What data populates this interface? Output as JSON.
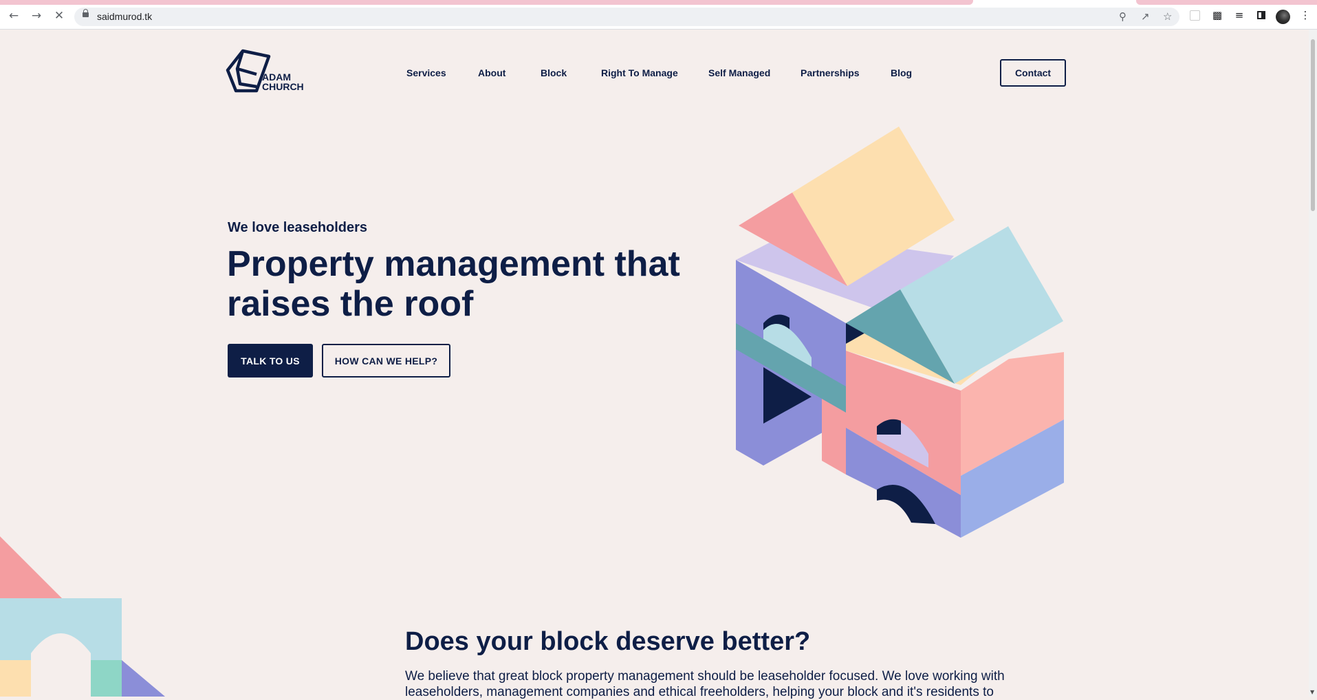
{
  "browser": {
    "url": "saidmurod.tk",
    "back_icon": "arrow-left-icon",
    "forward_icon": "arrow-right-icon",
    "stop_icon": "close-icon"
  },
  "site": {
    "logo_line1": "ADAM",
    "logo_line2": "CHURCH",
    "nav": [
      "Services",
      "About",
      "Block",
      "Right To Manage",
      "Self Managed",
      "Partnerships",
      "Blog"
    ],
    "contact_label": "Contact"
  },
  "hero": {
    "eyebrow": "We love leaseholders",
    "title": "Property management that raises the roof",
    "primary_cta": "TALK TO US",
    "secondary_cta": "HOW CAN WE HELP?"
  },
  "section": {
    "title": "Does your block deserve better?",
    "body": "We believe that great block property management should be leaseholder focused. We love working with leaseholders, management companies and ethical freeholders, helping your block and it's residents to"
  },
  "colors": {
    "navy": "#0e1e46",
    "background": "#f5eeec",
    "pink": "#f49da0",
    "peach": "#fddfaf",
    "lavender": "#cec5ec",
    "periwinkle": "#8b8ed8",
    "teal": "#64a4ae",
    "light_blue": "#b7dde6"
  }
}
